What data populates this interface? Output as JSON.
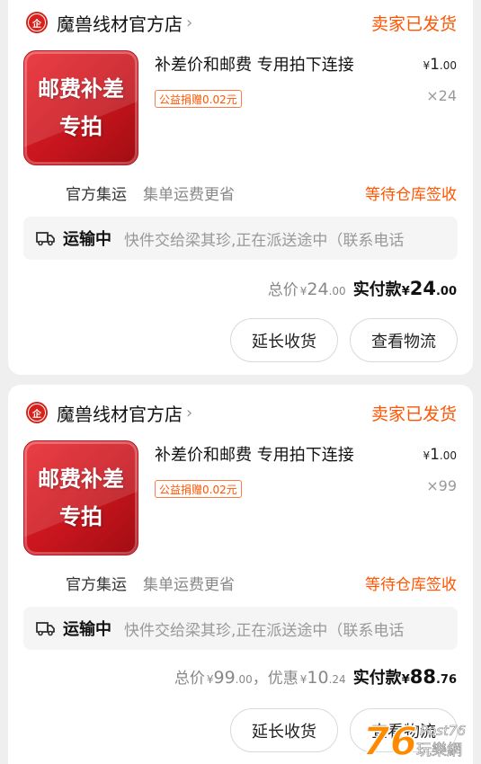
{
  "orders": [
    {
      "shop_name": "魔兽线材官方店",
      "shop_logo_text": "企",
      "status": "卖家已发货",
      "thumb_line1": "邮费补差",
      "thumb_line2": "专拍",
      "product_title": "补差价和邮费 专用拍下连接",
      "charity_tag": "公益捐赠0.02元",
      "price_currency": "¥",
      "price_int": "1",
      "price_dec": ".00",
      "quantity": "×24",
      "ship_type": "官方集运",
      "ship_note": "集单运费更省",
      "warehouse_status": "等待仓库签收",
      "logistics_status": "运输中",
      "logistics_detail": "快件交给梁其珍,正在派送途中（联系电话",
      "total_label": "总价",
      "total_currency": "¥",
      "total_int": "24",
      "total_dec": ".00",
      "discount_label": "",
      "discount_currency": "",
      "discount_int": "",
      "discount_dec": "",
      "paid_label": "实付款",
      "paid_currency": "¥",
      "paid_int": "24",
      "paid_dec": ".00",
      "btn_extend": "延长收货",
      "btn_track": "查看物流"
    },
    {
      "shop_name": "魔兽线材官方店",
      "shop_logo_text": "企",
      "status": "卖家已发货",
      "thumb_line1": "邮费补差",
      "thumb_line2": "专拍",
      "product_title": "补差价和邮费 专用拍下连接",
      "charity_tag": "公益捐赠0.02元",
      "price_currency": "¥",
      "price_int": "1",
      "price_dec": ".00",
      "quantity": "×99",
      "ship_type": "官方集运",
      "ship_note": "集单运费更省",
      "warehouse_status": "等待仓库签收",
      "logistics_status": "运输中",
      "logistics_detail": "快件交给梁其珍,正在派送途中（联系电话",
      "total_label": "总价",
      "total_currency": "¥",
      "total_int": "99",
      "total_dec": ".00",
      "discount_label": "，优惠",
      "discount_currency": "¥",
      "discount_int": "10",
      "discount_dec": ".24",
      "paid_label": "实付款",
      "paid_currency": "¥",
      "paid_int": "88",
      "paid_dec": ".76",
      "btn_extend": "延长收货",
      "btn_track": "查看物流"
    }
  ],
  "watermark": {
    "number": "76",
    "brand": "Post76",
    "subtitle": "玩樂網"
  },
  "colors": {
    "accent": "#ff5500",
    "brand_red": "#d7221c"
  }
}
